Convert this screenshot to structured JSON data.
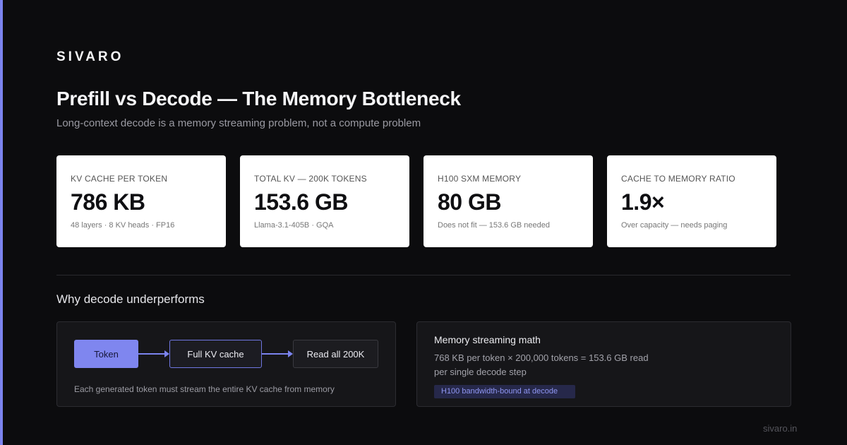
{
  "brand": "SIVARO",
  "title": "Prefill vs Decode — The Memory Bottleneck",
  "subtitle": "Long-context decode is a memory streaming problem, not a compute problem",
  "stats": [
    {
      "label": "KV CACHE PER TOKEN",
      "value": "786 KB",
      "note": "48 layers · 8 KV heads · FP16"
    },
    {
      "label": "TOTAL KV — 200K TOKENS",
      "value": "153.6 GB",
      "note": "Llama-3.1-405B · GQA"
    },
    {
      "label": "H100 SXM MEMORY",
      "value": "80 GB",
      "note": "Does not fit — 153.6 GB needed"
    },
    {
      "label": "CACHE TO MEMORY RATIO",
      "value": "1.9×",
      "note": "Over capacity — needs paging"
    }
  ],
  "section_title": "Why decode underperforms",
  "flow": {
    "token": "Token",
    "kv_cache": "Full KV cache",
    "read_all": "Read all 200K",
    "caption": "Each generated token must stream the entire KV cache from memory"
  },
  "math": {
    "title": "Memory streaming math",
    "line1": "768 KB per token × 200,000 tokens = 153.6 GB read",
    "line2": "per single decode step",
    "badge": "H100 bandwidth-bound at decode"
  },
  "footer": "sivaro.in",
  "colors": {
    "background": "#0c0c0e",
    "accent": "#7b83ee",
    "card": "#ffffff",
    "panel": "#161619"
  }
}
